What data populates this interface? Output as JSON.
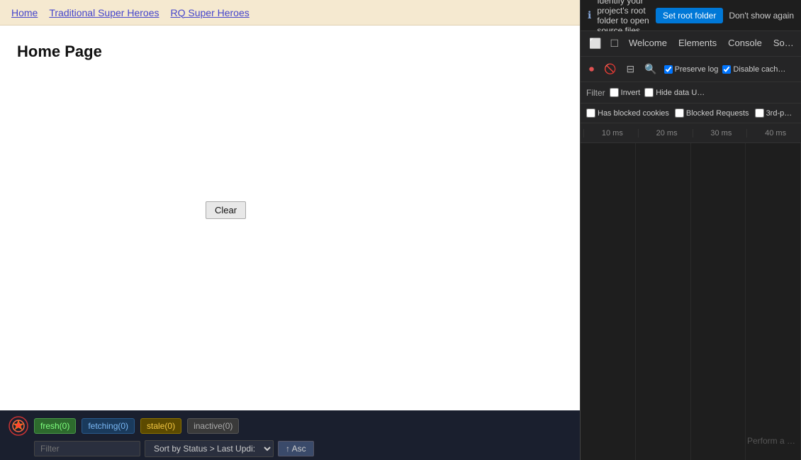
{
  "nav": {
    "links": [
      "Home",
      "Traditional Super Heroes",
      "RQ Super Heroes"
    ]
  },
  "page": {
    "title": "Home Page",
    "clear_button": "Clear"
  },
  "devtools_query": {
    "badges": [
      {
        "label": "fresh(0)",
        "type": "fresh"
      },
      {
        "label": "fetching(0)",
        "type": "fetching"
      },
      {
        "label": "stale(0)",
        "type": "stale"
      },
      {
        "label": "inactive(0)",
        "type": "inactive"
      }
    ],
    "filter_placeholder": "Filter",
    "sort_value": "Sort by Status > Last Updi:",
    "asc_label": "↑ Asc"
  },
  "devtools_panel": {
    "info_text": "Identify your project's root folder to open source files",
    "set_root_label": "Set root folder",
    "dont_show_label": "Don't show again",
    "tabs": [
      "Welcome",
      "Elements",
      "Console",
      "So…"
    ],
    "toolbar": {
      "preserve_log": "Preserve log",
      "disable_cache": "Disable cach…"
    },
    "filter_label": "Filter",
    "filter_options": {
      "invert": "Invert",
      "hide_data": "Hide data U…"
    },
    "checkboxes": {
      "has_blocked": "Has blocked cookies",
      "blocked_requests": "Blocked Requests",
      "third_party": "3rd-p…"
    },
    "time_ticks": [
      "10 ms",
      "20 ms",
      "30 ms",
      "40 ms"
    ],
    "perform_text": "Perform a …"
  }
}
